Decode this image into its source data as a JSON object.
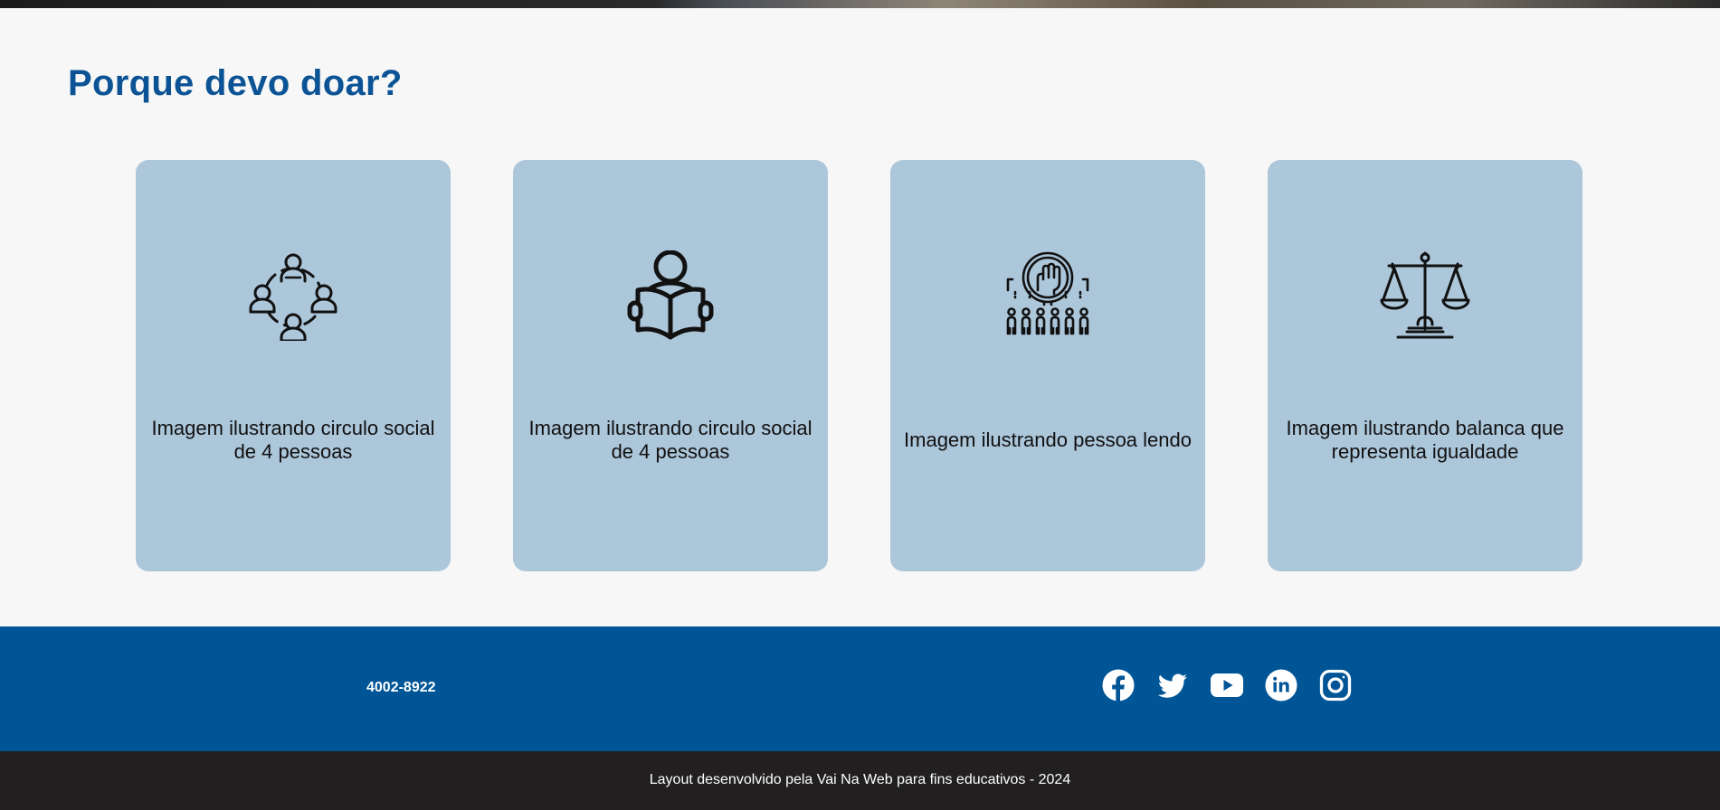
{
  "section": {
    "title": "Porque devo doar?",
    "cards": [
      {
        "icon": "social-circle-icon",
        "caption": "Imagem ilustrando circulo social de 4 pessoas"
      },
      {
        "icon": "person-reading-icon",
        "caption": "Imagem ilustrando circulo social de 4 pessoas"
      },
      {
        "icon": "raised-fist-crowd-icon",
        "caption": "Imagem ilustrando pessoa lendo"
      },
      {
        "icon": "balance-scale-icon",
        "caption": "Imagem ilustrando balanca que representa igualdade"
      }
    ]
  },
  "footer": {
    "phone": "4002-8922",
    "socials": [
      "facebook-icon",
      "twitter-icon",
      "youtube-icon",
      "linkedin-icon",
      "instagram-icon"
    ]
  },
  "bottom": {
    "credits": "Layout desenvolvido pela Vai Na Web para fins educativos - 2024"
  },
  "colors": {
    "title": "#0b5395",
    "card": "#acc6da",
    "footer": "#005597",
    "bottom_bar": "#211f1f",
    "page_bg": "#f7f7f7"
  }
}
